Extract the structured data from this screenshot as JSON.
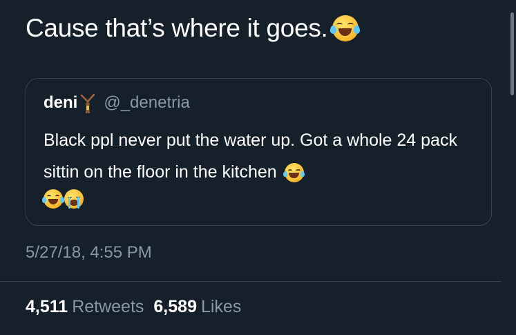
{
  "tweet": {
    "text": "Cause that’s where it goes.",
    "text_emoji": "face-with-tears-of-joy-icon"
  },
  "quoted_tweet": {
    "display_name": "deni",
    "name_emoji": "person-doing-cartwheel-icon",
    "handle": "@_denetria",
    "body": "Black ppl never put the water up. Got a whole 24 pack sittin on the floor in the kitchen",
    "trailing_emojis": [
      "face-with-tears-of-joy-icon",
      "face-with-tears-of-joy-icon",
      "loudly-crying-face-icon"
    ]
  },
  "timestamp": "5/27/18, 4:55 PM",
  "stats": {
    "retweets_count": "4,511",
    "retweets_label": "Retweets",
    "likes_count": "6,589",
    "likes_label": "Likes"
  },
  "colors": {
    "background": "#15202b",
    "text_primary": "#ffffff",
    "text_secondary": "#8899a6",
    "border": "#38444d"
  }
}
